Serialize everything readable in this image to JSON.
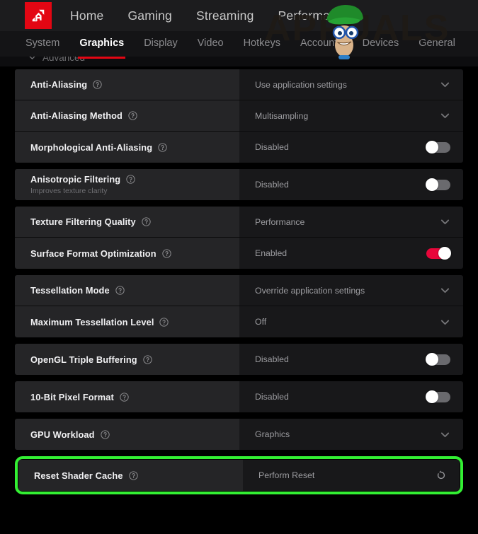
{
  "app": {
    "logo_icon": "amd-logo-icon",
    "watermark_text": "APPUALS",
    "watermark_mascot": "mascot-icon"
  },
  "topnav": {
    "items": [
      {
        "label": "Home"
      },
      {
        "label": "Gaming"
      },
      {
        "label": "Streaming"
      },
      {
        "label": "Performance"
      }
    ]
  },
  "subnav": {
    "items": [
      {
        "label": "System",
        "active": false
      },
      {
        "label": "Graphics",
        "active": true
      },
      {
        "label": "Display",
        "active": false
      },
      {
        "label": "Video",
        "active": false
      },
      {
        "label": "Hotkeys",
        "active": false
      },
      {
        "label": "Accounts",
        "active": false
      },
      {
        "label": "Devices",
        "active": false
      },
      {
        "label": "General",
        "active": false
      }
    ]
  },
  "advanced": {
    "label": "Advanced",
    "chevron_icon": "chevron-down-icon"
  },
  "groups": [
    {
      "rows": [
        {
          "label": "Anti-Aliasing",
          "sublabel": "",
          "help_icon": "help-circle-icon",
          "value": "Use application settings",
          "control": "dropdown",
          "control_icon": "chevron-down-icon"
        },
        {
          "label": "Anti-Aliasing Method",
          "sublabel": "",
          "help_icon": "help-circle-icon",
          "value": "Multisampling",
          "control": "dropdown",
          "control_icon": "chevron-down-icon"
        },
        {
          "label": "Morphological Anti-Aliasing",
          "sublabel": "",
          "help_icon": "help-circle-icon",
          "value": "Disabled",
          "control": "toggle",
          "toggle_on": false
        }
      ]
    },
    {
      "rows": [
        {
          "label": "Anisotropic Filtering",
          "sublabel": "Improves texture clarity",
          "help_icon": "help-circle-icon",
          "value": "Disabled",
          "control": "toggle",
          "toggle_on": false
        }
      ]
    },
    {
      "rows": [
        {
          "label": "Texture Filtering Quality",
          "sublabel": "",
          "help_icon": "help-circle-icon",
          "value": "Performance",
          "control": "dropdown",
          "control_icon": "chevron-down-icon"
        },
        {
          "label": "Surface Format Optimization",
          "sublabel": "",
          "help_icon": "help-circle-icon",
          "value": "Enabled",
          "control": "toggle",
          "toggle_on": true
        }
      ]
    },
    {
      "rows": [
        {
          "label": "Tessellation Mode",
          "sublabel": "",
          "help_icon": "help-circle-icon",
          "value": "Override application settings",
          "control": "dropdown",
          "control_icon": "chevron-down-icon"
        },
        {
          "label": "Maximum Tessellation Level",
          "sublabel": "",
          "help_icon": "help-circle-icon",
          "value": "Off",
          "control": "dropdown",
          "control_icon": "chevron-down-icon"
        }
      ]
    },
    {
      "rows": [
        {
          "label": "OpenGL Triple Buffering",
          "sublabel": "",
          "help_icon": "help-circle-icon",
          "value": "Disabled",
          "control": "toggle",
          "toggle_on": false
        }
      ]
    },
    {
      "rows": [
        {
          "label": "10-Bit Pixel Format",
          "sublabel": "",
          "help_icon": "help-circle-icon",
          "value": "Disabled",
          "control": "toggle",
          "toggle_on": false
        }
      ]
    },
    {
      "rows": [
        {
          "label": "GPU Workload",
          "sublabel": "",
          "help_icon": "help-circle-icon",
          "value": "Graphics",
          "control": "dropdown",
          "control_icon": "chevron-down-icon"
        }
      ]
    },
    {
      "highlighted": true,
      "highlight_color": "#33f033",
      "rows": [
        {
          "label": "Reset Shader Cache",
          "sublabel": "",
          "help_icon": "help-circle-icon",
          "value": "Perform Reset",
          "control": "reset",
          "control_icon": "reset-arrow-icon"
        }
      ]
    }
  ]
}
